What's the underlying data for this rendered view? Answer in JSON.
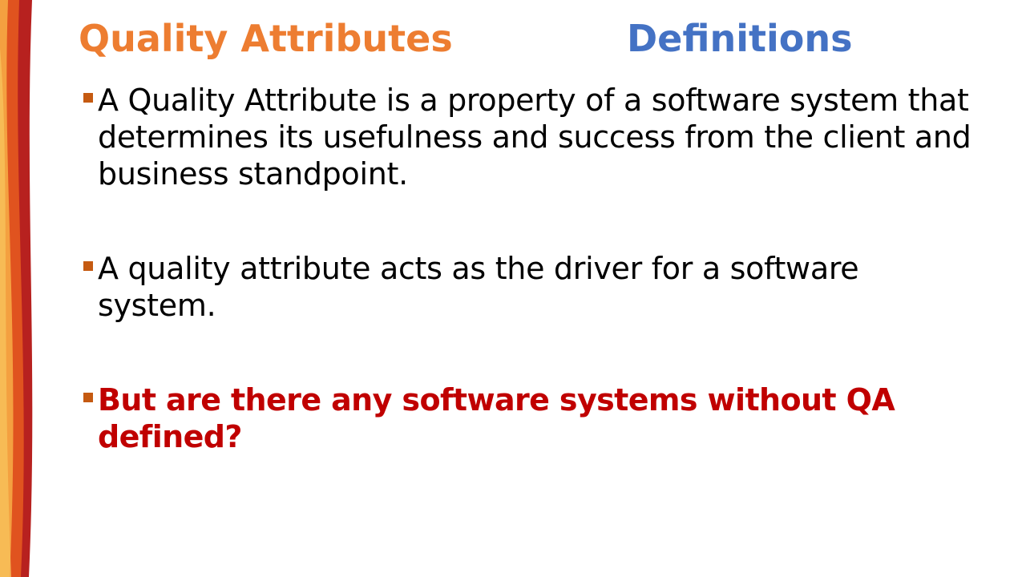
{
  "slide": {
    "title_left": "Quality Attributes",
    "title_right": "Definitions"
  },
  "bullets": [
    {
      "text": "A Quality Attribute is a property of a software system that determines its usefulness and success from the client and business standpoint.",
      "color": "#000000"
    },
    {
      "text": "A quality attribute acts as the driver for a software system.",
      "color": "#000000"
    },
    {
      "text": "But are there any software systems without QA defined?",
      "color": "#C00000"
    }
  ],
  "colors": {
    "title_left": "#ED7D31",
    "title_right": "#4472C4",
    "bullet_marker": "#C55A11",
    "emphasis": "#C00000"
  }
}
